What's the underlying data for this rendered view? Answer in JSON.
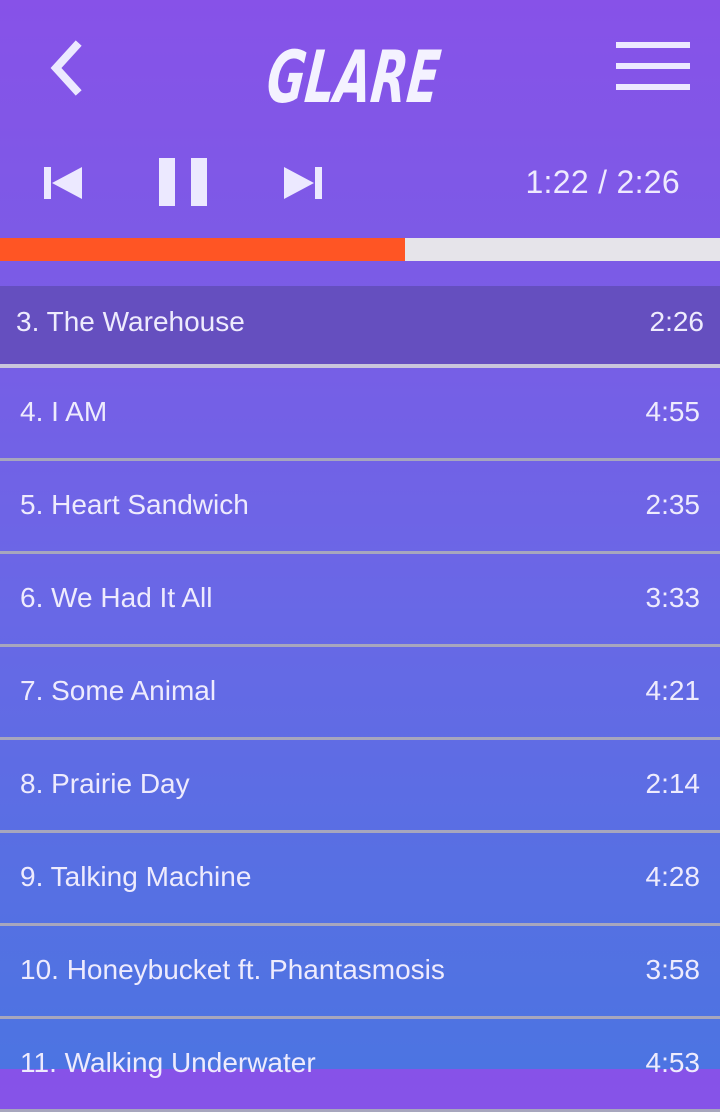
{
  "app": {
    "logo_text": "GLARE",
    "back_icon": "chevron-left-icon",
    "menu_icon": "hamburger-menu-icon"
  },
  "player": {
    "prev_icon": "skip-previous-icon",
    "pause_icon": "pause-icon",
    "next_icon": "skip-next-icon",
    "time_text": "1:22 / 2:26",
    "progress_fraction": 0.5625
  },
  "colors": {
    "progress_fill": "#ff5524",
    "progress_track": "#e6e4ea",
    "current_row_bg": "#654fbf"
  },
  "tracks": [
    {
      "title": "3. The Warehouse",
      "duration": "2:26",
      "current": true
    },
    {
      "title": "4. I AM",
      "duration": "4:55"
    },
    {
      "title": "5. Heart Sandwich",
      "duration": "2:35"
    },
    {
      "title": "6. We Had It All",
      "duration": "3:33"
    },
    {
      "title": "7. Some Animal",
      "duration": "4:21"
    },
    {
      "title": "8. Prairie Day",
      "duration": "2:14"
    },
    {
      "title": "9. Talking Machine",
      "duration": "4:28"
    },
    {
      "title": "10. Honeybucket ft. Phantasmosis",
      "duration": "3:58"
    },
    {
      "title": "11. Walking Underwater",
      "duration": "4:53"
    }
  ]
}
